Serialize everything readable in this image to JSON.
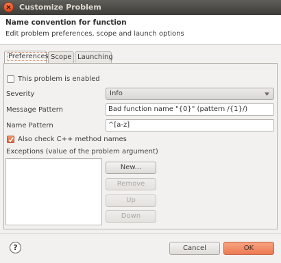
{
  "window": {
    "title": "Customize Problem"
  },
  "header": {
    "title": "Name convention for function",
    "description": "Edit problem preferences, scope and launch options"
  },
  "tabs": [
    {
      "label": "Preferences",
      "active": true
    },
    {
      "label": "Scope",
      "active": false
    },
    {
      "label": "Launching",
      "active": false
    }
  ],
  "preferences": {
    "enabled_label": "This problem is enabled",
    "enabled_checked": false,
    "severity_label": "Severity",
    "severity_value": "Info",
    "message_pattern_label": "Message Pattern",
    "message_pattern_value": "Bad function name \"{0}\" (pattern /{1}/)",
    "name_pattern_label": "Name Pattern",
    "name_pattern_value": "^[a-z]",
    "check_cpp_label": "Also check C++ method names",
    "check_cpp_checked": true,
    "exceptions_label": "Exceptions (value of the problem argument)",
    "exceptions_items": [],
    "buttons": {
      "new": "New...",
      "remove": "Remove",
      "up": "Up",
      "down": "Down"
    }
  },
  "footer": {
    "help_icon": "?",
    "cancel": "Cancel",
    "ok": "OK"
  },
  "colors": {
    "titlebar": "#3d3c38",
    "accent": "#ec7a52",
    "panel_bg": "#f2f1f0"
  }
}
